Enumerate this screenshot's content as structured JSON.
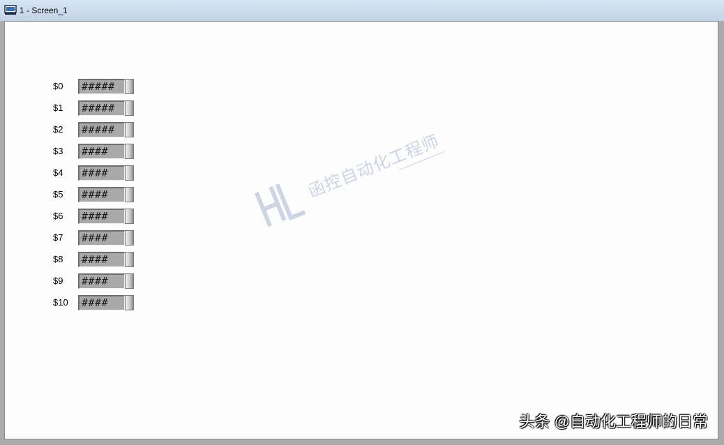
{
  "window": {
    "title": "1 - Screen_1",
    "icon": "monitor-icon"
  },
  "rows": [
    {
      "tag": "$0",
      "value": "#####"
    },
    {
      "tag": "$1",
      "value": "#####"
    },
    {
      "tag": "$2",
      "value": "#####"
    },
    {
      "tag": "$3",
      "value": "####"
    },
    {
      "tag": "$4",
      "value": "####"
    },
    {
      "tag": "$5",
      "value": "####"
    },
    {
      "tag": "$6",
      "value": "####"
    },
    {
      "tag": "$7",
      "value": "####"
    },
    {
      "tag": "$8",
      "value": "####"
    },
    {
      "tag": "$9",
      "value": "####"
    },
    {
      "tag": "$10",
      "value": "####"
    }
  ],
  "watermark": {
    "text": "函控自动化工程师",
    "logo": "H-logo"
  },
  "credit": "头条 @自动化工程师的日常"
}
